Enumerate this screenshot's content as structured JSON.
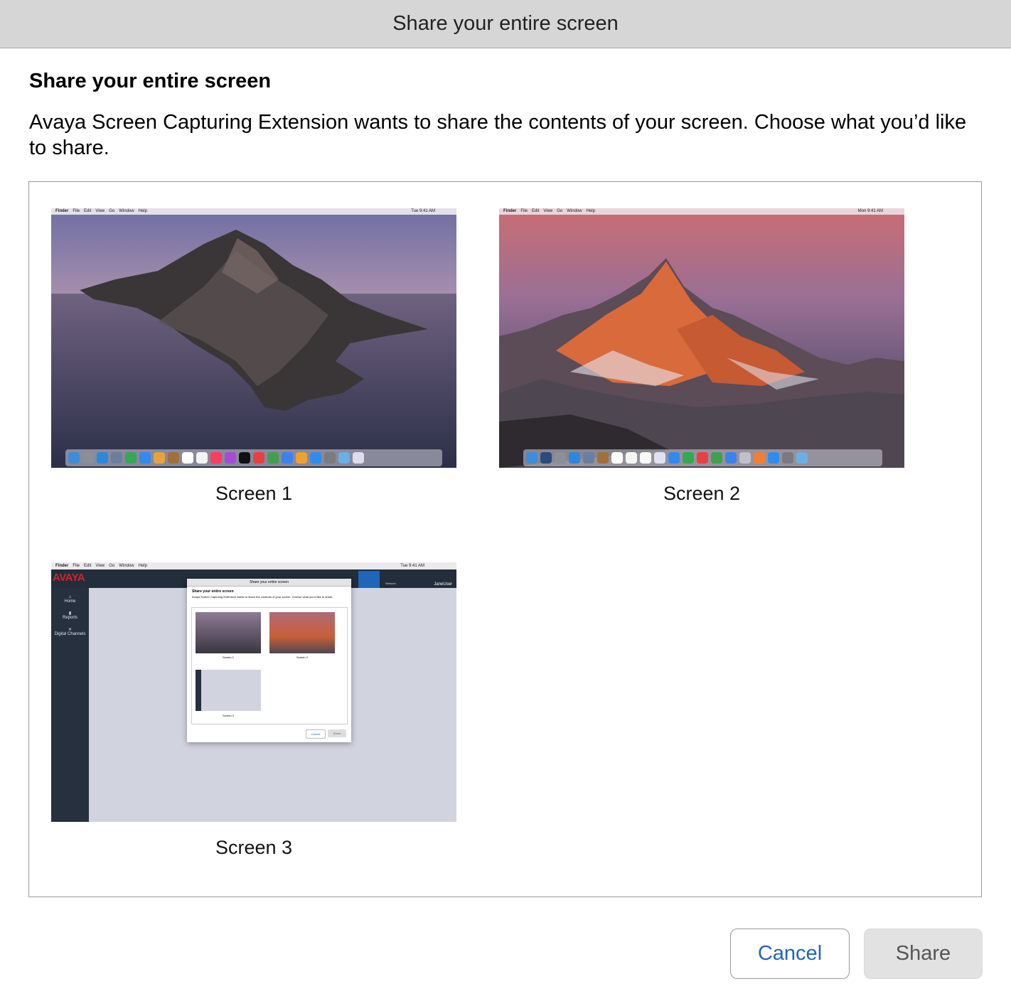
{
  "window": {
    "title": "Share your entire screen"
  },
  "dialog": {
    "heading": "Share your entire screen",
    "description": "Avaya Screen Capturing Extension wants to share the contents of your screen. Choose what you’d like to share."
  },
  "screens": [
    {
      "label": "Screen 1",
      "menu": [
        "Finder",
        "File",
        "Edit",
        "View",
        "Go",
        "Window",
        "Help"
      ],
      "clock": "Tue 9:41 AM"
    },
    {
      "label": "Screen 2",
      "menu": [
        "Finder",
        "File",
        "Edit",
        "View",
        "Go",
        "Window",
        "Help"
      ],
      "clock": "Mon 9:41 AM"
    },
    {
      "label": "Screen 3",
      "menu": [
        "Finder",
        "File",
        "Edit",
        "View",
        "Go",
        "Window",
        "Help"
      ],
      "clock": "Tue 9:41 AM",
      "app": {
        "logo": "AVAYA",
        "nav": [
          "Home",
          "Reports",
          "Digital Channels"
        ],
        "network_label": "Network",
        "user": "JaneUser",
        "dialog_title": "Share your entire screen",
        "dialog_heading": "Share your entire screen",
        "dialog_text": "Avaya Screen Capturing Extension wants to share the contents of your screen. Choose what you'd like to share.",
        "screens": [
          "Screen 1",
          "Screen 2",
          "Screen 3"
        ],
        "cancel": "Cancel",
        "share": "Share"
      }
    }
  ],
  "buttons": {
    "cancel": "Cancel",
    "share": "Share"
  },
  "colors": {
    "accent": "#1f66b8",
    "titlebar": "#d6d6d6",
    "disabled_button": "#e2e2e2"
  }
}
